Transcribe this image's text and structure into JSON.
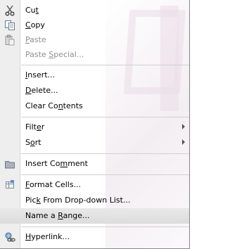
{
  "menu": {
    "items": [
      {
        "id": "cut",
        "pre": "Cu",
        "key": "t",
        "post": "",
        "icon": "scissors-icon",
        "disabled": false
      },
      {
        "id": "copy",
        "pre": "",
        "key": "C",
        "post": "opy",
        "icon": "copy-icon",
        "disabled": false
      },
      {
        "id": "paste",
        "pre": "",
        "key": "P",
        "post": "aste",
        "icon": "paste-icon",
        "disabled": true
      },
      {
        "id": "paste-special",
        "pre": "Paste ",
        "key": "S",
        "post": "pecial...",
        "icon": "",
        "disabled": true
      },
      {
        "id": "insert",
        "pre": "",
        "key": "I",
        "post": "nsert...",
        "icon": "",
        "disabled": false
      },
      {
        "id": "delete",
        "pre": "",
        "key": "D",
        "post": "elete...",
        "icon": "",
        "disabled": false
      },
      {
        "id": "clear-contents",
        "pre": "Clear Co",
        "key": "n",
        "post": "tents",
        "icon": "",
        "disabled": false
      },
      {
        "id": "filter",
        "pre": "Filt",
        "key": "e",
        "post": "r",
        "icon": "",
        "disabled": false,
        "submenu": true
      },
      {
        "id": "sort",
        "pre": "S",
        "key": "o",
        "post": "rt",
        "icon": "",
        "disabled": false,
        "submenu": true
      },
      {
        "id": "insert-comment",
        "pre": "Insert Co",
        "key": "m",
        "post": "ment",
        "icon": "comment-icon",
        "disabled": false
      },
      {
        "id": "format-cells",
        "pre": "",
        "key": "F",
        "post": "ormat Cells...",
        "icon": "format-cells-icon",
        "disabled": false
      },
      {
        "id": "pick-from-list",
        "pre": "Pic",
        "key": "k",
        "post": " From Drop-down List...",
        "icon": "",
        "disabled": false
      },
      {
        "id": "name-a-range",
        "pre": "Name a ",
        "key": "R",
        "post": "ange...",
        "icon": "",
        "disabled": false
      },
      {
        "id": "hyperlink",
        "pre": "",
        "key": "H",
        "post": "yperlink...",
        "icon": "hyperlink-icon",
        "disabled": false
      }
    ]
  }
}
